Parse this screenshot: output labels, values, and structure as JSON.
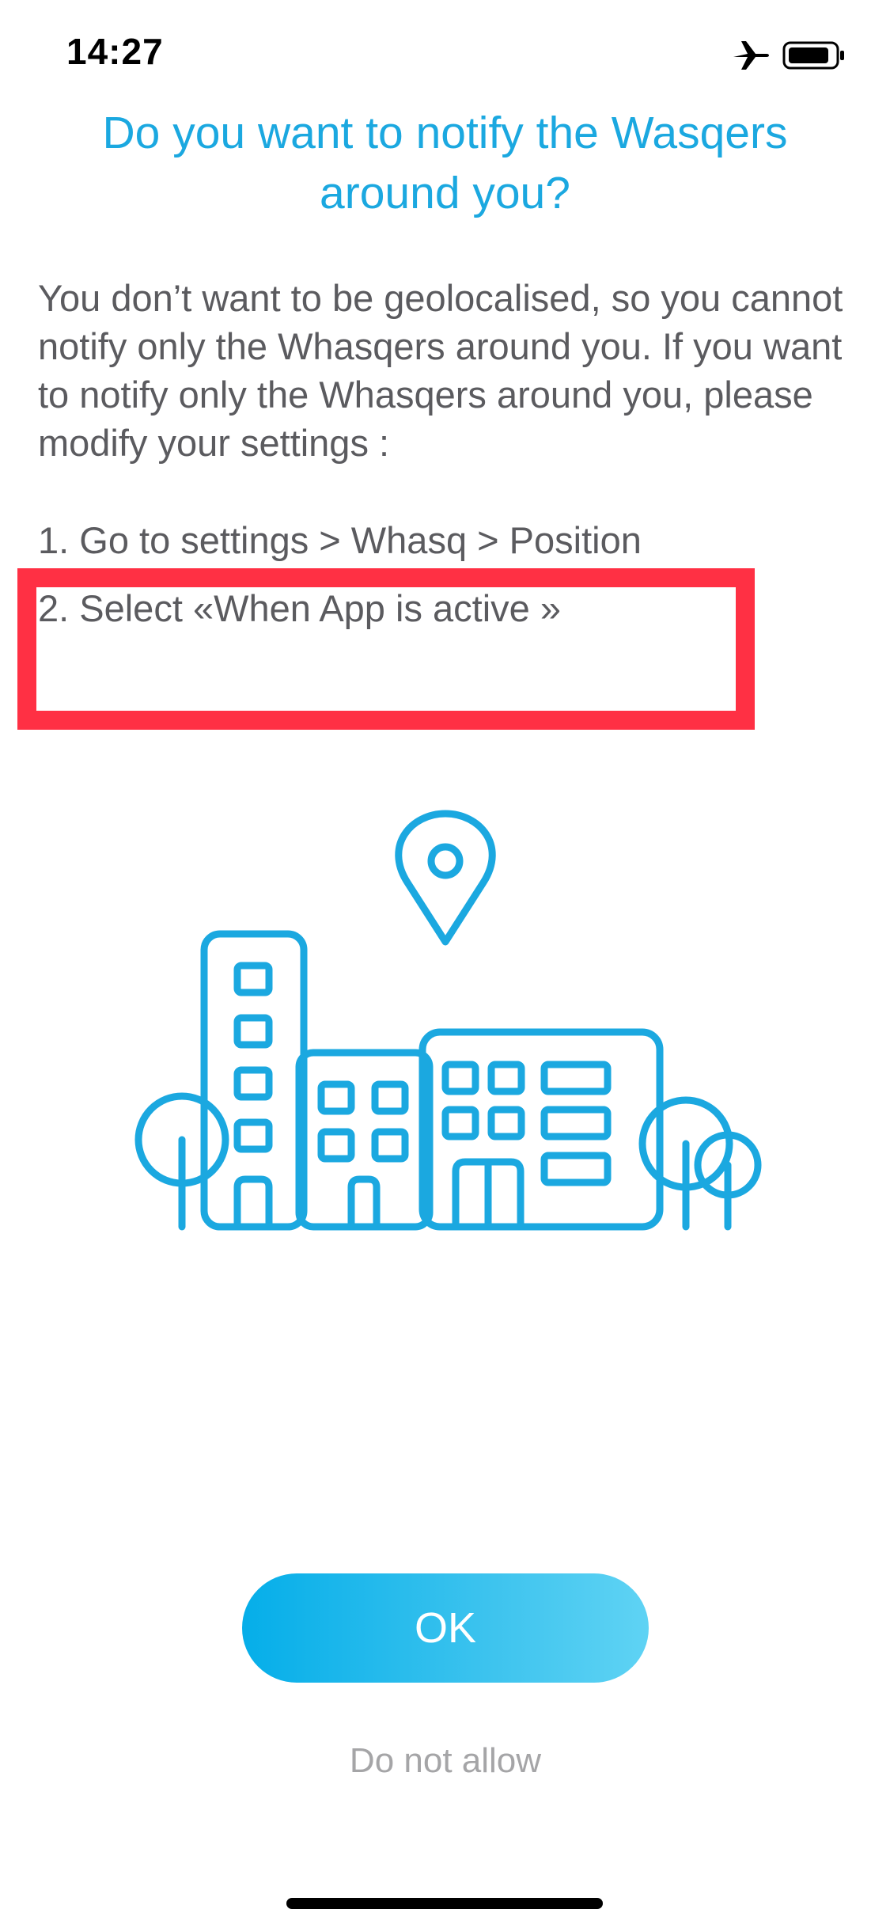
{
  "status_bar": {
    "time": "14:27",
    "icons": [
      "airplane-icon",
      "battery-icon"
    ]
  },
  "dialog": {
    "title": "Do you want to notify the Wasqers around you?",
    "body": "You don’t want to be geolocalised, so you cannot notify only the Whasqers around you. If you want to notify only the Whasqers around you, please modify your settings :",
    "steps": [
      "1. Go to settings > Whasq > Position",
      "2. Select «When App is active »"
    ],
    "illustration_icon": "city-buildings-location-pin-icon",
    "ok_label": "OK",
    "deny_label": "Do not allow"
  },
  "colors": {
    "accent": "#1BA8E0",
    "text": "#5B5B5F",
    "highlight": "#FF3044",
    "button_gradient_start": "#05AEE9",
    "button_gradient_end": "#5FD3F4",
    "muted": "#A5A5A7"
  }
}
